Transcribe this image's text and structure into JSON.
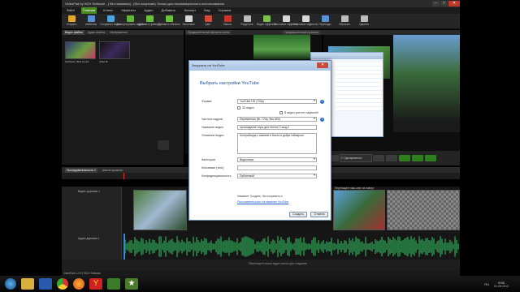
{
  "window": {
    "title": "VideoPad by NCH Software - [ без названия] - (без лицензии) Только для некоммерческого использования",
    "min": "–",
    "max": "□",
    "close": "✕"
  },
  "menu": [
    "Файл",
    "Главная",
    "Клипы",
    "Эффекты",
    "Аудио",
    "Добавить",
    "Экспорт",
    "Вид",
    "Справка"
  ],
  "toolbar": [
    {
      "label": "Открыть",
      "icon": "open-icon",
      "color": "#e0a82e"
    },
    {
      "label": "Шаблоны",
      "icon": "templates-icon",
      "color": "#5b8fd8"
    },
    {
      "label": "Сохранить видео",
      "icon": "save-video-icon",
      "color": "#4ba3e0"
    },
    {
      "label": "Экспортировать видео",
      "icon": "export-icon",
      "color": "#64b33a"
    },
    {
      "label": "Добавить файл(ы)",
      "icon": "add-file-icon",
      "color": "#6bbf3c"
    },
    {
      "label": "Добавить объекты",
      "icon": "add-objects-icon",
      "color": "#6bbf3c"
    },
    {
      "label": "Заголовок",
      "icon": "title-icon",
      "color": "#d6d6d6"
    },
    {
      "label": "Цвет",
      "icon": "color-icon",
      "color": "#d14a3c"
    },
    {
      "label": "Запись",
      "icon": "record-icon",
      "color": "#c9352a"
    },
    {
      "label": "Разделить",
      "icon": "split-icon",
      "color": "#bbbbbb"
    },
    {
      "label": "Видео эффекты",
      "icon": "video-effects-icon",
      "color": "#7ac04a"
    },
    {
      "label": "Текстовые эффекты",
      "icon": "text-effects-icon",
      "color": "#d6d6d6"
    },
    {
      "label": "Текстовые эффекты",
      "icon": "text-effects-2-icon",
      "color": "#d6d6d6"
    },
    {
      "label": "Переходы",
      "icon": "transitions-icon",
      "color": "#5b8fd8"
    },
    {
      "label": "Обрезать",
      "icon": "crop-icon",
      "color": "#bbbbbb"
    },
    {
      "label": "Удалить",
      "icon": "delete-icon",
      "color": "#bbbbbb"
    }
  ],
  "bin_tabs": [
    "Видео файлы",
    "Аудио файлы",
    "Изображения"
  ],
  "media": [
    {
      "caption": "SunDown 2011 (1).avi"
    },
    {
      "caption": "video.flv"
    }
  ],
  "preview_tabs": [
    "Предварительный просмотр клипа",
    "Предварительный просмотр"
  ],
  "timeline": {
    "tabs": [
      "Последовательность 1",
      "Шкала времени"
    ],
    "video_track": "Видео дорожка 1",
    "audio_track": "Аудио дорожка 1",
    "drop_hint": "Перетащите ваши аудио клипы для создания",
    "drag_hint": "Перетащите ваш клип на поверх",
    "transport_labels": [
      "Отрезать",
      "Открыть",
      "Экспорт"
    ],
    "transport_value": "С Одновременно"
  },
  "status": "VideoPad v 2.5 © NCH Software",
  "dialog": {
    "title": "Загрузить на YouTube",
    "heading": "Выбрать настройки YouTube",
    "fields": [
      {
        "label": "Формат",
        "value": "YouTube HD (720p)",
        "select": true
      },
      {
        "label": "Частота кадров",
        "value": "Переменная (Вт, 720p, Вес 800)",
        "select": true
      },
      {
        "label": "Название видео",
        "value": "прохождение игры для теплее 2 мод-2",
        "select": false
      },
      {
        "label": "Описание видео",
        "value": "Контрабанда с камнем и Настя в добре геймером",
        "select": false
      },
      {
        "label": "Категория",
        "value": "Видеоигры",
        "select": true
      },
      {
        "label": "Ключевые (теги)",
        "value": "",
        "select": false
      },
      {
        "label": "Конфиденциальность",
        "value": "Публичный",
        "select": true
      }
    ],
    "checkbox_1": "3D видео",
    "checkbox_2": "В видео уже нет надписей",
    "note": "Нажмите 'Создать', бы сохранить и",
    "link": "Пользовательское соглашение YouTube",
    "ok": "Создать",
    "cancel": "Отмена"
  },
  "taskbar": {
    "clock_time": "9:56",
    "clock_date": "01.05.2012",
    "lang": "RU",
    "icons": [
      "start-orb-icon",
      "explorer-icon",
      "media-icon",
      "chrome-icon",
      "firefox-icon",
      "yandex-icon",
      "videopad-icon",
      "green-star-icon"
    ]
  }
}
